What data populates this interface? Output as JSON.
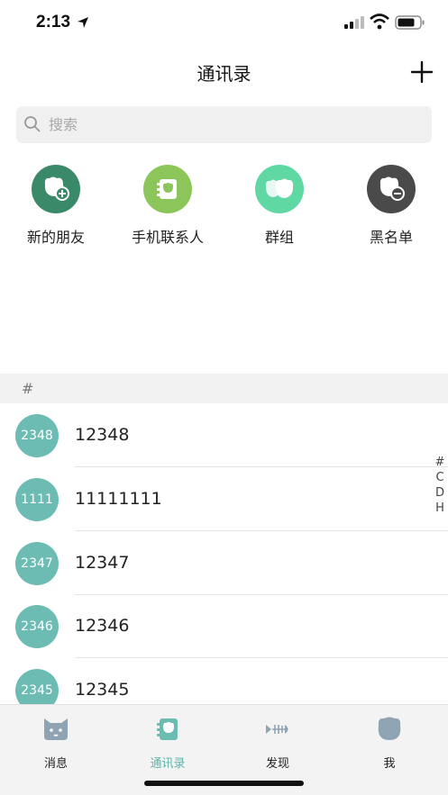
{
  "status_bar": {
    "time": "2:13"
  },
  "nav": {
    "title": "通讯录",
    "add_icon": "plus-icon"
  },
  "search": {
    "placeholder": "搜索"
  },
  "quick_entries": [
    {
      "label": "新的朋友",
      "icon": "add-friend-icon",
      "color": "#3a8a6a"
    },
    {
      "label": "手机联系人",
      "icon": "phone-contacts-icon",
      "color": "#8cc65a"
    },
    {
      "label": "群组",
      "icon": "group-icon",
      "color": "#5fd8a4"
    },
    {
      "label": "黑名单",
      "icon": "blacklist-icon",
      "color": "#4a4a4a"
    }
  ],
  "index_section": "#",
  "contacts": [
    {
      "avatar_text": "2348",
      "name": "12348"
    },
    {
      "avatar_text": "1111",
      "name": "11111111"
    },
    {
      "avatar_text": "2347",
      "name": "12347"
    },
    {
      "avatar_text": "2346",
      "name": "12346"
    },
    {
      "avatar_text": "2345",
      "name": "12345"
    }
  ],
  "index_letters": [
    "#",
    "C",
    "D",
    "H"
  ],
  "tabs": [
    {
      "label": "消息",
      "icon": "message-icon",
      "active": false
    },
    {
      "label": "通讯录",
      "icon": "contacts-icon",
      "active": true
    },
    {
      "label": "发现",
      "icon": "discover-icon",
      "active": false
    },
    {
      "label": "我",
      "icon": "me-icon",
      "active": false
    }
  ],
  "colors": {
    "accent": "#5fb3a8",
    "avatar": "#6cbcb3"
  }
}
